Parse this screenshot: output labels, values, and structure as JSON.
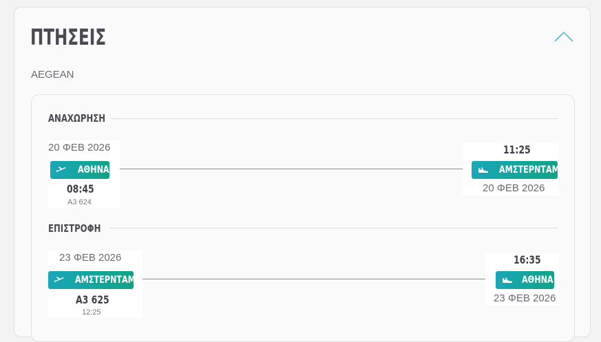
{
  "section": {
    "title": "ΠΤΗΣΕΙΣ",
    "airline": "AEGEAN"
  },
  "outbound": {
    "label": "ΑΝΑΧΩΡΗΣΗ",
    "origin": {
      "date": "20 ΦΕΒ 2026",
      "city": "ΑΘΗΝΑ",
      "time": "08:45",
      "flight_no": "A3 624"
    },
    "destination": {
      "time": "11:25",
      "city": "ΑΜΣΤΕΡΝΤΑΜ",
      "date": "20 ΦΕΒ 2026"
    }
  },
  "return": {
    "label": "ΕΠΙΣΤΡΟΦΗ",
    "origin": {
      "date": "23 ΦΕΒ 2026",
      "city": "ΑΜΣΤΕΡΝΤΑΜ",
      "time": "A3 625",
      "flight_no": "12:25"
    },
    "destination": {
      "time": "16:35",
      "city": "ΑΘΗΝΑ",
      "date": "23 ΦΕΒ 2026"
    }
  },
  "colors": {
    "accent": "#1aa7b7",
    "pill_end": "#10a387",
    "heading": "#4a4a52"
  },
  "icons": {
    "toggle": "chevron-up-icon",
    "takeoff": "plane-takeoff-icon",
    "landing": "plane-landing-icon"
  }
}
